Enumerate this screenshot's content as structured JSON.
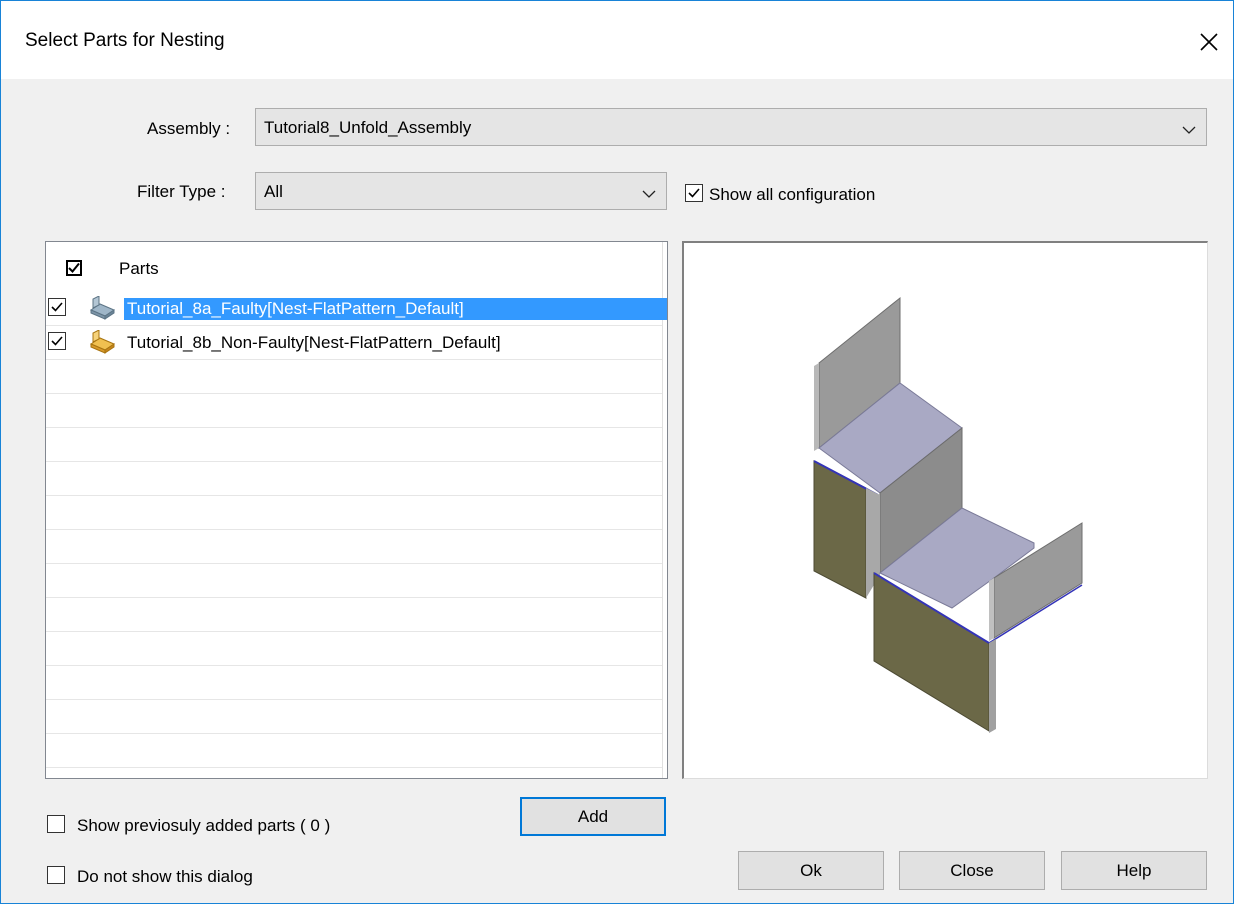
{
  "window": {
    "title": "Select Parts for Nesting"
  },
  "assembly": {
    "label": "Assembly :",
    "value": "Tutorial8_Unfold_Assembly"
  },
  "filter": {
    "label": "Filter Type :",
    "value": "All"
  },
  "show_all_config": {
    "label": "Show all configuration",
    "checked": true
  },
  "tree": {
    "root": {
      "label": "Parts",
      "checked": true
    },
    "items": [
      {
        "label": "Tutorial_8a_Faulty[Nest-FlatPattern_Default]",
        "checked": true,
        "selected": true,
        "icon": "part-icon-blue"
      },
      {
        "label": "Tutorial_8b_Non-Faulty[Nest-FlatPattern_Default]",
        "checked": true,
        "selected": false,
        "icon": "part-icon-orange"
      }
    ]
  },
  "options": {
    "show_previous_label": "Show previosuly added parts ( 0 )",
    "show_previous_checked": false,
    "do_not_show_label": "Do not show this dialog",
    "do_not_show_checked": false
  },
  "buttons": {
    "add": "Add",
    "ok": "Ok",
    "close": "Close",
    "help": "Help"
  },
  "colors": {
    "selection": "#3399ff",
    "accent_border": "#0078d7"
  }
}
